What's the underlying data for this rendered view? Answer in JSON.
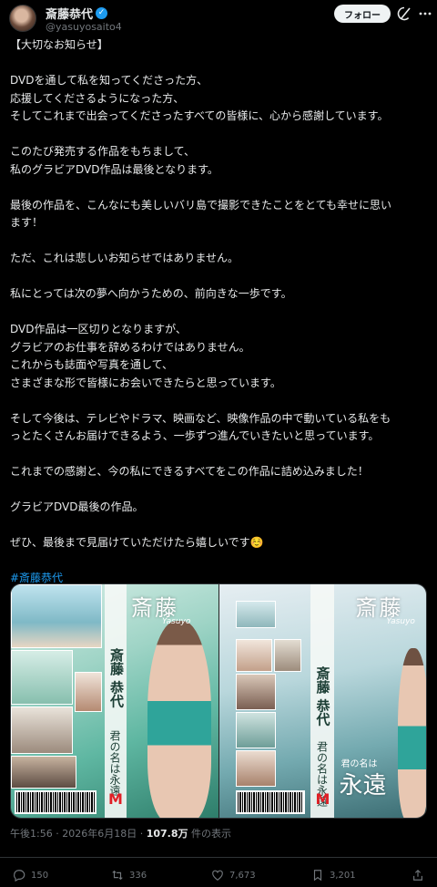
{
  "author": {
    "display_name": "斎藤恭代",
    "handle": "@yasuyosaito4",
    "verified_icon": "verified-badge-icon"
  },
  "header": {
    "follow_label": "フォロー"
  },
  "tweet": {
    "lines": [
      "【大切なお知らせ】",
      "",
      "DVDを通して私を知ってくださった方、",
      "応援してくださるようになった方、",
      "そしてこれまで出会ってくださったすべての皆様に、心から感謝しています。",
      "",
      "このたび発売する作品をもちまして、",
      "私のグラビアDVD作品は最後となります。",
      "",
      "最後の作品を、こんなにも美しいバリ島で撮影できたことをとても幸せに思い",
      "ます！",
      "",
      "ただ、これは悲しいお知らせではありません。",
      "",
      "私にとっては次の夢へ向かうための、前向きな一歩です。",
      "",
      "DVD作品は一区切りとなりますが、",
      "グラビアのお仕事を辞めるわけではありません。",
      "これからも誌面や写真を通して、",
      "さまざまな形で皆様にお会いできたらと思っています。",
      "",
      "そして今後は、テレビやドラマ、映画など、映像作品の中で動いている私をも",
      "っとたくさんお届けできるよう、一歩ずつ進んでいきたいと思っています。",
      "",
      "これまでの感謝と、今の私にできるすべてをこの作品に詰め込みました！",
      "",
      "グラビアDVD最後の作品。",
      "",
      "ぜひ、最後まで見届けていただけたら嬉しいです☺️",
      ""
    ],
    "hashtag": "#斎藤恭代"
  },
  "media": {
    "left_cover": {
      "title": "斎藤",
      "subtitle": "Yasuyo",
      "vertical_name": "斎藤 恭代",
      "vertical_title": "君の名は永遠",
      "logo": "M"
    },
    "right_cover": {
      "title": "斎藤",
      "subtitle": "Yasuyo",
      "vertical_name": "斎藤 恭代",
      "vertical_title": "君の名は永遠",
      "title_large": "永遠",
      "title_small": "君の名は",
      "logo": "M"
    }
  },
  "meta": {
    "time": "午後1:56",
    "separator": "·",
    "date": "2026年6月18日",
    "views_count": "107.8万",
    "views_label": "件の表示"
  },
  "actions": {
    "replies": "150",
    "reposts": "336",
    "likes": "7,673",
    "bookmarks": "3,201"
  },
  "colors": {
    "background": "#000000",
    "text": "#e7e9ea",
    "muted": "#71767b",
    "accent": "#1d9bf0"
  }
}
